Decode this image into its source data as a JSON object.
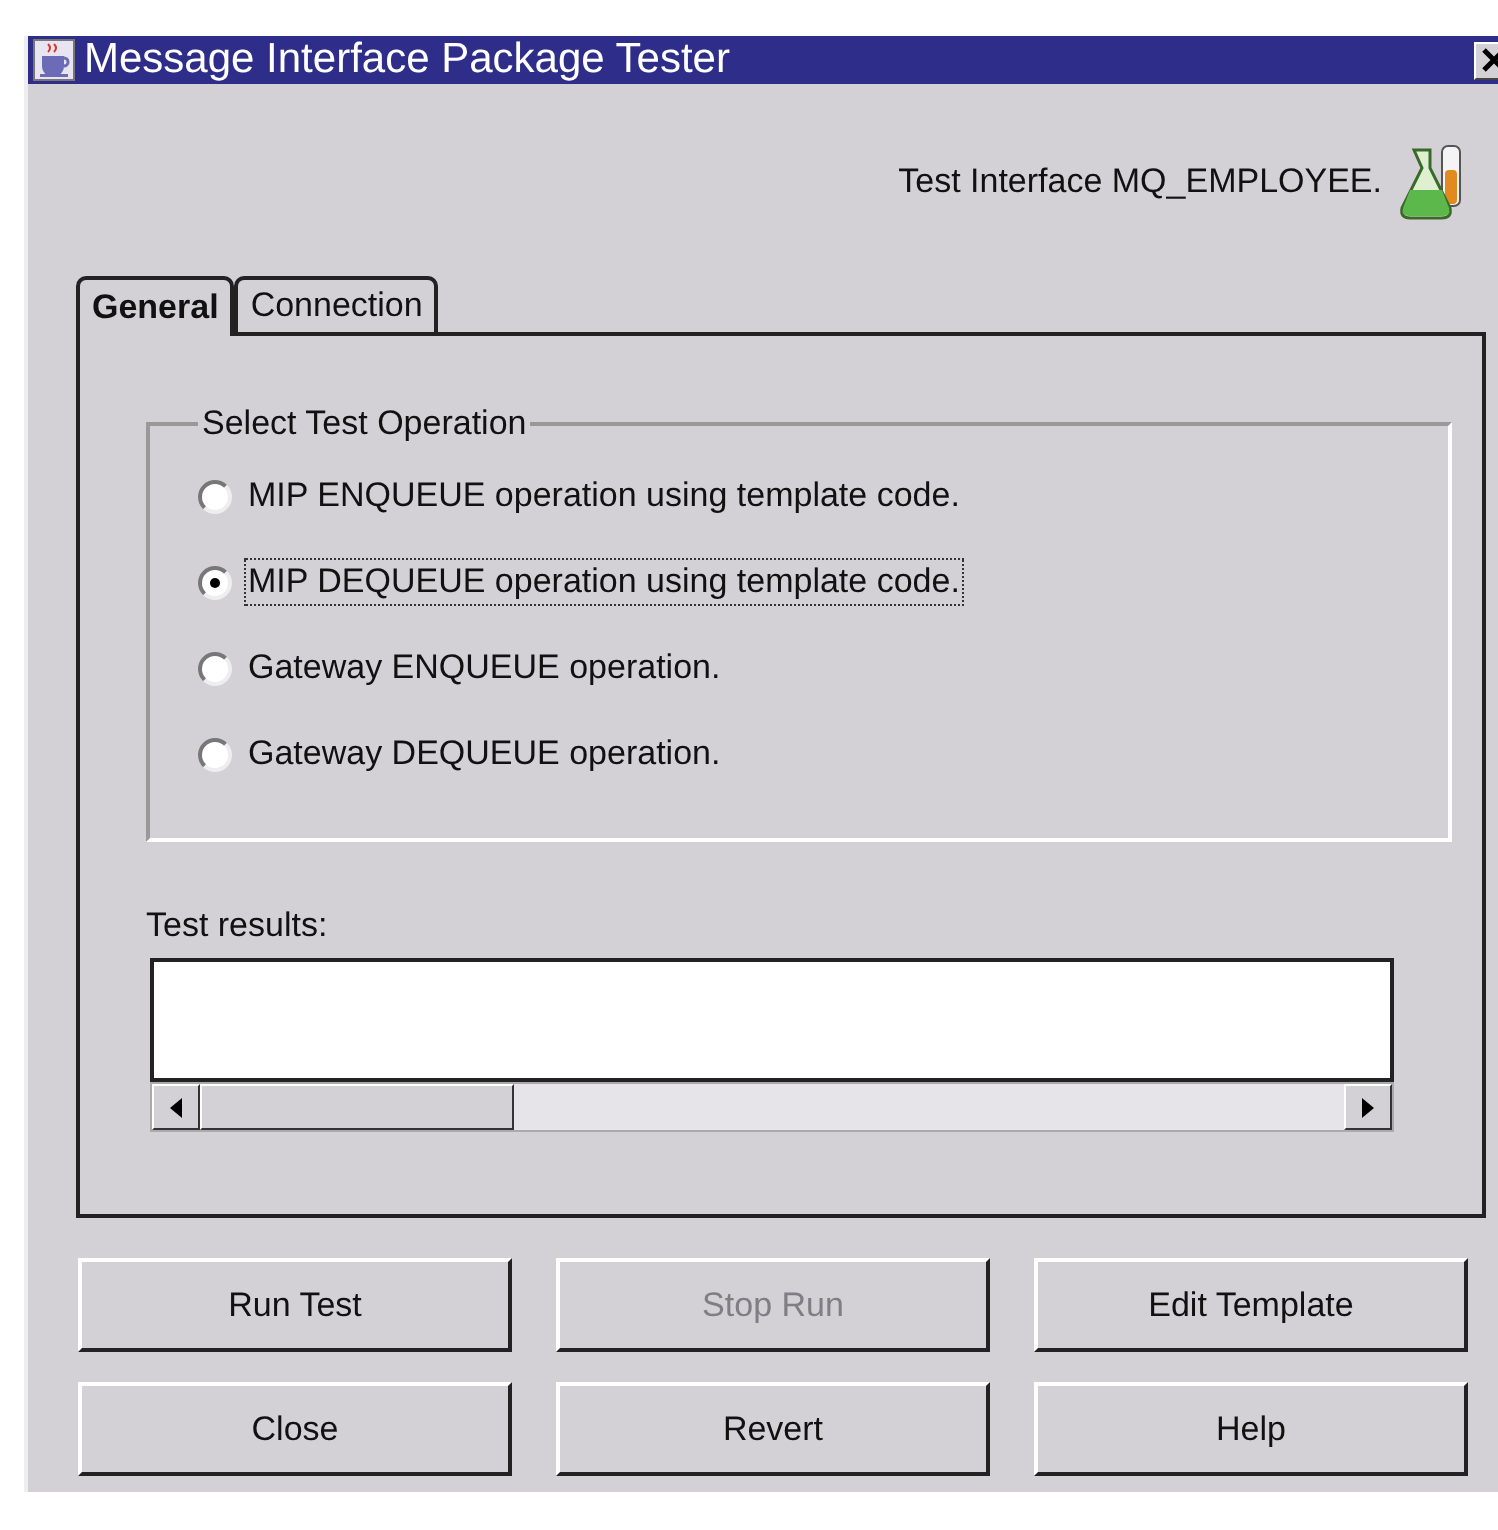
{
  "window": {
    "title": "Message Interface Package Tester"
  },
  "header": {
    "text": "Test Interface MQ_EMPLOYEE."
  },
  "tabs": [
    {
      "label": "General",
      "selected": true
    },
    {
      "label": "Connection",
      "selected": false
    }
  ],
  "operation_group": {
    "title": "Select Test Operation",
    "options": [
      {
        "label": "MIP ENQUEUE operation using template code.",
        "selected": false,
        "focused": false
      },
      {
        "label": "MIP DEQUEUE operation using template code.",
        "selected": true,
        "focused": true
      },
      {
        "label": "Gateway ENQUEUE operation.",
        "selected": false,
        "focused": false
      },
      {
        "label": "Gateway DEQUEUE operation.",
        "selected": false,
        "focused": false
      }
    ]
  },
  "results": {
    "label": "Test results:"
  },
  "buttons": [
    {
      "label": "Run Test",
      "disabled": false
    },
    {
      "label": "Stop Run",
      "disabled": true
    },
    {
      "label": "Edit Template",
      "disabled": false
    },
    {
      "label": "Close",
      "disabled": false
    },
    {
      "label": "Revert",
      "disabled": false
    },
    {
      "label": "Help",
      "disabled": false
    }
  ]
}
